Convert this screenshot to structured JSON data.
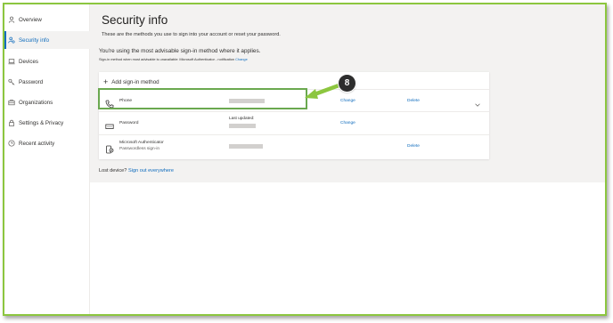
{
  "sidebar": {
    "items": [
      {
        "label": "Overview",
        "icon": "person-icon",
        "active": false
      },
      {
        "label": "Security info",
        "icon": "security-info-icon",
        "active": true
      },
      {
        "label": "Devices",
        "icon": "laptop-icon",
        "active": false
      },
      {
        "label": "Password",
        "icon": "key-icon",
        "active": false
      },
      {
        "label": "Organizations",
        "icon": "briefcase-icon",
        "active": false
      },
      {
        "label": "Settings & Privacy",
        "icon": "lock-icon",
        "active": false
      },
      {
        "label": "Recent activity",
        "icon": "clock-icon",
        "active": false
      }
    ]
  },
  "main": {
    "title": "Security info",
    "subtitle": "These are the methods you use to sign into your account or reset your password.",
    "advise_text": "You're using the most advisable sign-in method where it applies.",
    "advise_sub_text": "Sign-in method when most advisable is unavailable: Microsoft Authenticator - notification",
    "advise_sub_link": "Change",
    "add_method_label": "Add sign-in method",
    "methods": [
      {
        "name": "Phone",
        "icon": "phone-icon",
        "change_label": "Change",
        "delete_label": "Delete"
      },
      {
        "name": "Password",
        "icon": "password-icon",
        "detail_label": "Last updated:",
        "change_label": "Change"
      },
      {
        "name": "Microsoft Authenticator",
        "sub": "Passwordless sign-in",
        "icon": "authenticator-icon",
        "delete_label": "Delete"
      }
    ],
    "lost_device_text": "Lost device?",
    "lost_device_link": "Sign out everywhere"
  },
  "annotation": {
    "callout_number": "8",
    "color": "#8cc63f"
  },
  "colors": {
    "accent": "#0f6cbd",
    "page_bg": "#f3f2f1",
    "highlight": "#6aa84f"
  }
}
